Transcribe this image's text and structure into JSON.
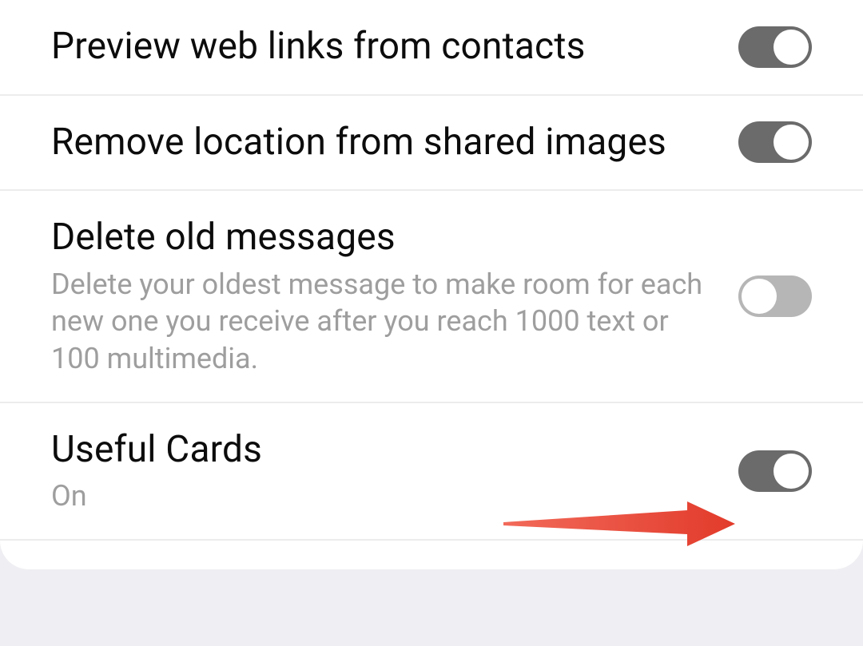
{
  "settings": [
    {
      "title": "Preview web links from contacts",
      "subtitle": "",
      "on": true
    },
    {
      "title": "Remove location from shared images",
      "subtitle": "",
      "on": true
    },
    {
      "title": "Delete old messages",
      "subtitle": "Delete your oldest message to make room for each new one you receive after you reach 1000 text or 100 multimedia.",
      "on": false
    },
    {
      "title": "Useful Cards",
      "subtitle": "On",
      "on": true
    }
  ],
  "annotation": {
    "type": "arrow-callout",
    "points_to": "useful-cards-toggle"
  }
}
